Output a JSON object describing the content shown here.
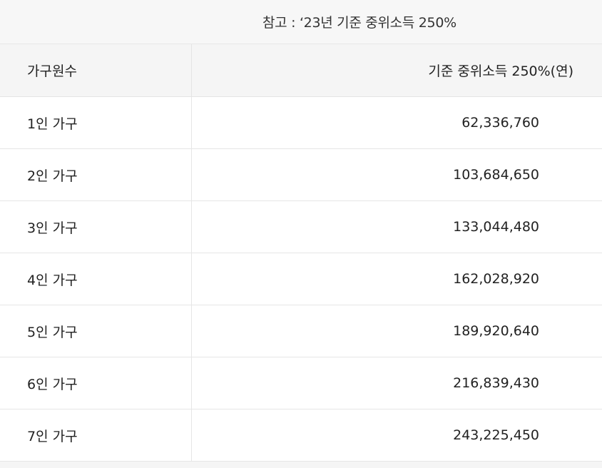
{
  "caption": "참고 : ‘23년 기준 중위소득 250%",
  "table": {
    "headers": [
      "가구원수",
      "기준 중위소득 250%(연)"
    ],
    "rows": [
      {
        "household": "1인 가구",
        "income": "62,336,760"
      },
      {
        "household": "2인 가구",
        "income": "103,684,650"
      },
      {
        "household": "3인 가구",
        "income": "133,044,480"
      },
      {
        "household": "4인 가구",
        "income": "162,028,920"
      },
      {
        "household": "5인 가구",
        "income": "189,920,640"
      },
      {
        "household": "6인 가구",
        "income": "216,839,430"
      },
      {
        "household": "7인 가구",
        "income": "243,225,450"
      }
    ]
  },
  "colors": {
    "header_bg": "#f5f5f5",
    "caption_bg": "#f7f7f7",
    "border": "#e6e6e6",
    "text": "#222222"
  }
}
